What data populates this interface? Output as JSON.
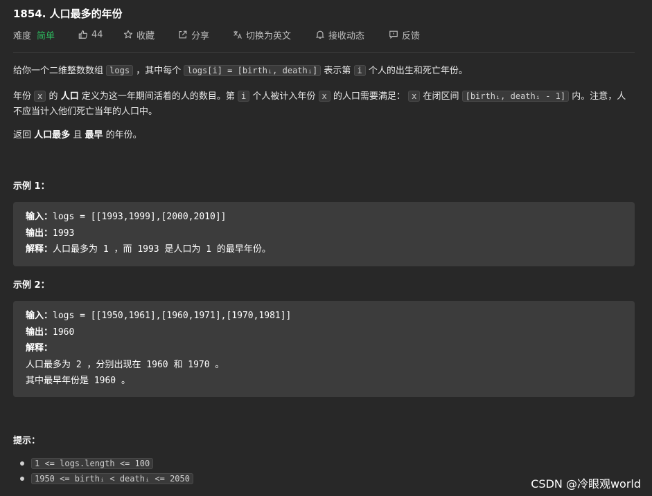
{
  "problem": {
    "title": "1854. 人口最多的年份"
  },
  "meta": {
    "difficulty_label": "难度",
    "difficulty_value": "简单",
    "likes": "44",
    "favorite_label": "收藏",
    "share_label": "分享",
    "translate_label": "切换为英文",
    "notify_label": "接收动态",
    "feedback_label": "反馈"
  },
  "description": {
    "p1_a": "给你一个二维整数数组",
    "p1_code1": "logs",
    "p1_b": "，其中每个",
    "p1_code2": "logs[i] = [birthᵢ, deathᵢ]",
    "p1_c": "表示第",
    "p1_code3": "i",
    "p1_d": "个人的出生和死亡年份。",
    "p2_a": "年份",
    "p2_code1": "x",
    "p2_b": "的",
    "p2_bold1": "人口",
    "p2_c": "定义为这一年期间活着的人的数目。第",
    "p2_code2": "i",
    "p2_d": "个人被计入年份",
    "p2_code3": "x",
    "p2_e": "的人口需要满足：",
    "p2_code4": "x",
    "p2_f": "在闭区间",
    "p2_code5": "[birthᵢ, deathᵢ - 1]",
    "p2_g": "内。注意，人不应当计入他们死亡当年的人口中。",
    "p3_a": "返回",
    "p3_bold1": "人口最多",
    "p3_b": "且",
    "p3_bold2": "最早",
    "p3_c": "的年份。"
  },
  "examples": [
    {
      "title": "示例 1：",
      "input_label": "输入：",
      "input": "logs = [[1993,1999],[2000,2010]]",
      "output_label": "输出：",
      "output": "1993",
      "explain_label": "解释：",
      "explain": "人口最多为 1 ，而 1993 是人口为 1 的最早年份。"
    },
    {
      "title": "示例 2：",
      "input_label": "输入：",
      "input": "logs = [[1950,1961],[1960,1971],[1970,1981]]",
      "output_label": "输出：",
      "output": "1960",
      "explain_label": "解释：",
      "explain_line1": "人口最多为 2 ，分别出现在 1960 和 1970 。",
      "explain_line2": "其中最早年份是 1960 。"
    }
  ],
  "tips": {
    "title": "提示：",
    "items": [
      "1 <= logs.length <= 100",
      "1950 <= birthᵢ < deathᵢ <= 2050"
    ]
  },
  "watermark": "CSDN @冷眼观world",
  "colors": {
    "background": "#282828",
    "difficulty_easy": "#2db55d",
    "example_bg": "#3c3c3c"
  }
}
